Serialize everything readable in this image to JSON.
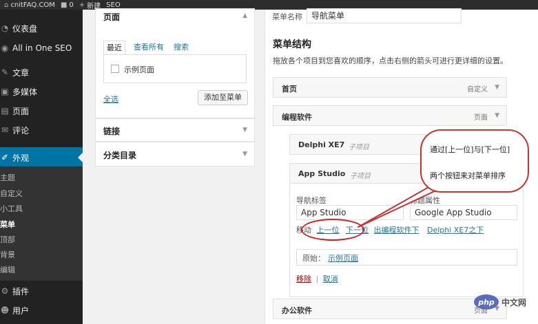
{
  "admin_bar": {
    "site_name": "cnitFAQ.COM",
    "comments_count": "0",
    "new_label": "新建",
    "seo_label": "SEO"
  },
  "sidebar": {
    "items": [
      {
        "label": "仪表盘",
        "icon": "dashboard-icon"
      },
      {
        "label": "All in One SEO",
        "icon": "seo-icon"
      },
      {
        "label": "文章",
        "icon": "pin-icon"
      },
      {
        "label": "多媒体",
        "icon": "media-icon"
      },
      {
        "label": "页面",
        "icon": "page-icon"
      },
      {
        "label": "评论",
        "icon": "comment-icon"
      },
      {
        "label": "外观",
        "icon": "brush-icon"
      },
      {
        "label": "插件",
        "icon": "plugin-icon"
      },
      {
        "label": "用户",
        "icon": "user-icon"
      }
    ],
    "submenu": [
      "主题",
      "自定义",
      "小工具",
      "菜单",
      "顶部",
      "背景",
      "编辑"
    ]
  },
  "left_panel": {
    "pages_title": "页面",
    "tabs": [
      "最近",
      "查看所有",
      "搜索"
    ],
    "sample_page": "示例页面",
    "select_all": "全选",
    "add_to_menu": "添加至菜单",
    "links_title": "链接",
    "categories_title": "分类目录"
  },
  "menu_editor": {
    "menu_name_label": "菜单名称",
    "menu_name_value": "导航菜单",
    "structure_title": "菜单结构",
    "structure_desc": "拖放各个项目到您喜欢的顺序，点击右侧的箭头可进行更详细的设置。",
    "items": [
      {
        "title": "首页",
        "type": "自定义"
      },
      {
        "title": "编程软件",
        "type": "页面"
      },
      {
        "title": "Delphi XE7",
        "sub": "子项目"
      },
      {
        "title": "App Studio",
        "sub": "子项目"
      },
      {
        "title": "办公软件",
        "type": "页面"
      }
    ],
    "nav_label_label": "导航标签",
    "nav_label_value": "App Studio",
    "title_attr_label": "标题属性",
    "title_attr_value": "Google App Studio",
    "move_prefix": "移动",
    "move_up": "上一位",
    "move_down": "下一位",
    "move_under_parent": "出编程软件下",
    "move_under_sibling": "Delphi XE7之下",
    "original_label": "原始：",
    "original_link": "示例页面",
    "remove": "移除",
    "separator": "|",
    "cancel": "取消"
  },
  "annotation": {
    "line1": "通过[上一位]与[下一位]",
    "line2": "两个按钮来对菜单排序"
  },
  "watermark": {
    "logo": "php",
    "text": "中文网"
  },
  "colors": {
    "sidebar_bg": "#222222",
    "active_bg": "#0074a2",
    "link": "#21759b",
    "annotation": "#d0201f"
  }
}
